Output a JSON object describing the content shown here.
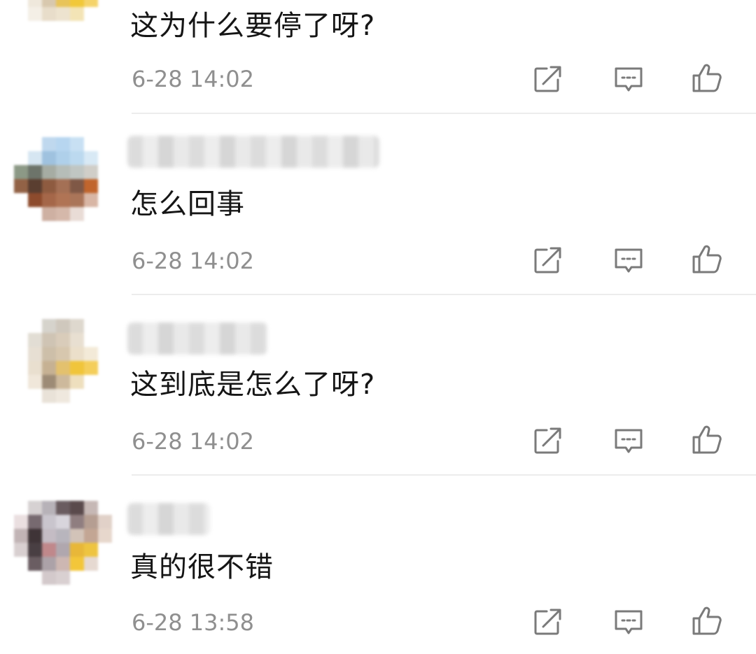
{
  "comments": [
    {
      "text": "这为什么要停了呀?",
      "time": "6-28 14:02"
    },
    {
      "text": "怎么回事",
      "time": "6-28 14:02"
    },
    {
      "text": "这到底是怎么了呀?",
      "time": "6-28 14:02"
    },
    {
      "text": "真的很不错",
      "time": "6-28 13:58"
    }
  ],
  "icons": {
    "share": "share-edit-icon",
    "reply": "comment-bubble-icon",
    "like": "thumbs-up-icon"
  },
  "colors": {
    "text": "#151515",
    "time": "#8f8f8f",
    "icon": "#7a7a7a",
    "divider": "#ececec"
  }
}
